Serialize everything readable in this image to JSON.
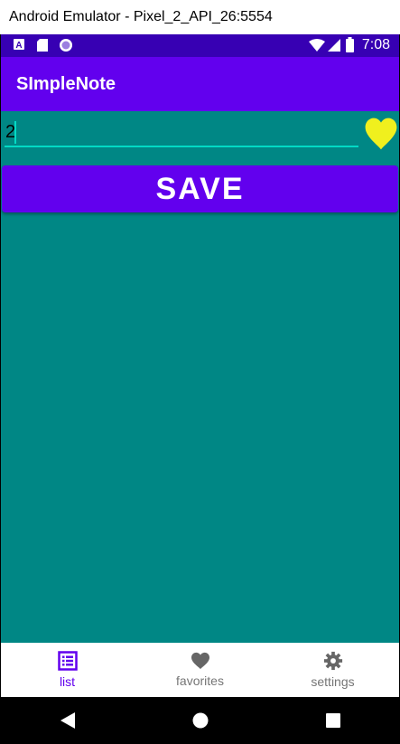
{
  "window": {
    "title": "Android Emulator - Pixel_2_API_26:5554"
  },
  "status_bar": {
    "time": "7:08",
    "icons": [
      "a-icon",
      "sd-card-icon",
      "circle-icon",
      "wifi-icon",
      "signal-icon",
      "battery-icon"
    ]
  },
  "app_bar": {
    "title": "SImpleNote"
  },
  "note": {
    "value": "2",
    "favorite_icon": "heart-icon"
  },
  "save_button": {
    "label": "SAVE"
  },
  "bottom_nav": {
    "items": [
      {
        "label": "list",
        "icon": "list-icon",
        "active": true
      },
      {
        "label": "favorites",
        "icon": "heart-icon",
        "active": false
      },
      {
        "label": "settings",
        "icon": "gear-icon",
        "active": false
      }
    ]
  },
  "system_nav": {
    "buttons": [
      "back-icon",
      "home-icon",
      "recents-icon"
    ]
  },
  "colors": {
    "status_bar": "#3700b3",
    "app_bar": "#6200ee",
    "content_bg": "#008785",
    "accent": "#03dac5",
    "heart": "#f0f01e",
    "nav_active": "#6200ee",
    "nav_inactive": "#757575"
  }
}
